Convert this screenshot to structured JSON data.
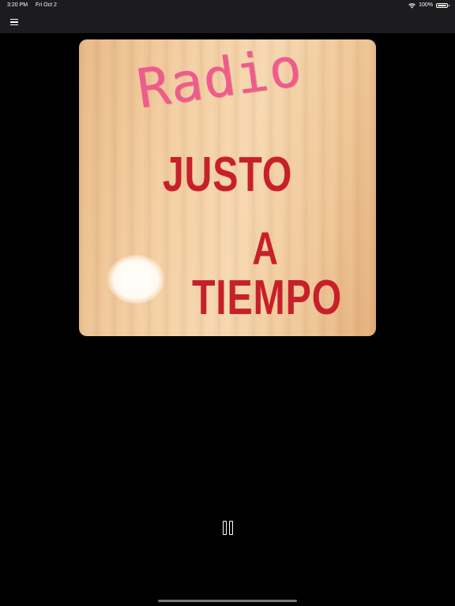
{
  "status_bar": {
    "time": "3:20 PM",
    "date": "Fri Oct 2",
    "battery": "100%",
    "battery_level": 1.0
  },
  "nav": {
    "menu_icon": "hamburger-menu-icon"
  },
  "artwork": {
    "radio_text": "Radio",
    "line1": "JUSTO",
    "line2": "A",
    "line3": "TIEMPO",
    "colors": {
      "radio": "#ee5b8c",
      "title": "#c8202a",
      "wood": "#f3cea2"
    }
  },
  "player": {
    "state_icon": "pause-icon"
  }
}
